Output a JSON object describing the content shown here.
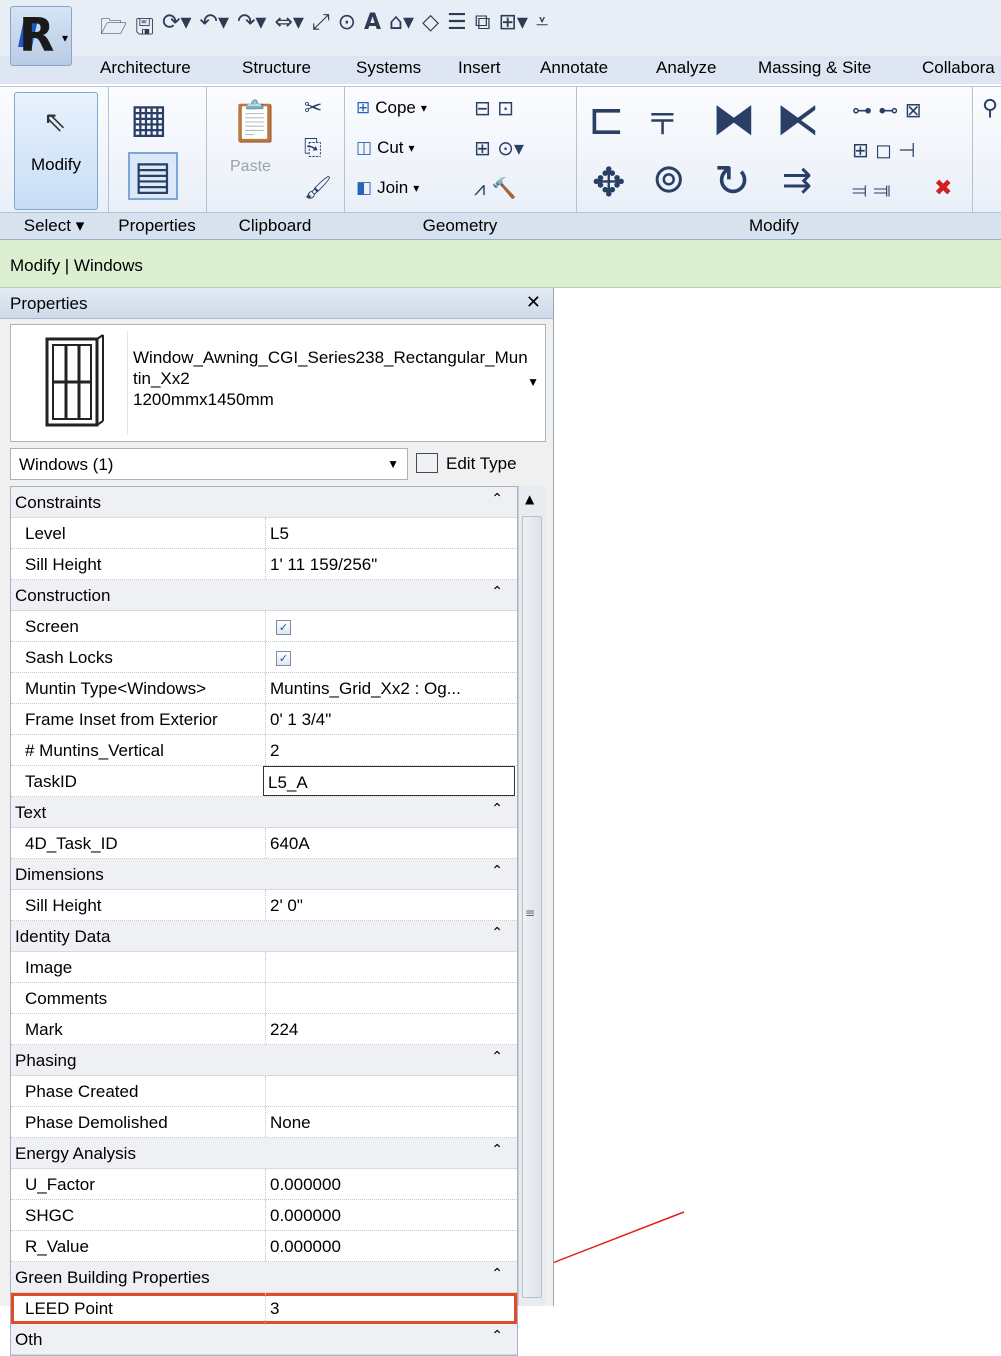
{
  "ribbon": {
    "tabs": [
      "Architecture",
      "Structure",
      "Systems",
      "Insert",
      "Annotate",
      "Analyze",
      "Massing & Site",
      "Collabora"
    ],
    "modify_label": "Modify",
    "paste_label": "Paste",
    "geometry": {
      "cope": "Cope",
      "cut": "Cut",
      "join": "Join"
    },
    "panels": {
      "select": "Select",
      "properties": "Properties",
      "clipboard": "Clipboard",
      "geometry": "Geometry",
      "modify": "Modify"
    }
  },
  "context_bar": "Modify | Windows",
  "properties": {
    "title": "Properties",
    "type_name": "Window_Awning_CGI_Series238_Rectangular_Muntin_Xx2",
    "type_size": "1200mmx1450mm",
    "instance_selector": "Windows (1)",
    "edit_type_label": "Edit Type",
    "groups": [
      {
        "name": "Constraints",
        "rows": [
          {
            "key": "Level",
            "value": "L5"
          },
          {
            "key": "Sill Height",
            "value": "1'  11 159/256\""
          }
        ]
      },
      {
        "name": "Construction",
        "rows": [
          {
            "key": "Screen",
            "value": "",
            "checkbox": true
          },
          {
            "key": "Sash Locks",
            "value": "",
            "checkbox": true
          },
          {
            "key": "Muntin Type<Windows>",
            "value": "Muntins_Grid_Xx2 : Og..."
          },
          {
            "key": "Frame Inset from Exterior",
            "value": "0'  1 3/4\""
          },
          {
            "key": "# Muntins_Vertical",
            "value": "2"
          },
          {
            "key": "TaskID",
            "value": "L5_A",
            "editing": true
          }
        ]
      },
      {
        "name": "Text",
        "rows": [
          {
            "key": "4D_Task_ID",
            "value": "640A"
          }
        ]
      },
      {
        "name": "Dimensions",
        "rows": [
          {
            "key": "Sill Height",
            "value": "2'  0\""
          }
        ]
      },
      {
        "name": "Identity Data",
        "rows": [
          {
            "key": "Image",
            "value": ""
          },
          {
            "key": "Comments",
            "value": ""
          },
          {
            "key": "Mark",
            "value": "224"
          }
        ]
      },
      {
        "name": "Phasing",
        "rows": [
          {
            "key": "Phase Created",
            "value": ""
          },
          {
            "key": "Phase Demolished",
            "value": "None"
          }
        ]
      },
      {
        "name": "Energy Analysis",
        "rows": [
          {
            "key": "U_Factor",
            "value": "0.000000"
          },
          {
            "key": "SHGC",
            "value": "0.000000"
          },
          {
            "key": "R_Value",
            "value": "0.000000"
          }
        ]
      },
      {
        "name": "Green Building Properties",
        "rows": [
          {
            "key": "LEED Point",
            "value": "3",
            "highlight": true
          }
        ]
      },
      {
        "name": "Oth",
        "rows": []
      }
    ]
  },
  "colors": {
    "highlight": "#e24a28",
    "arrow": "#e02020",
    "context_bar": "#dcefd1"
  }
}
